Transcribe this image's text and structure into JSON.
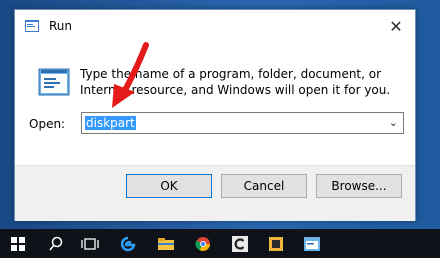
{
  "window": {
    "title": "Run",
    "close_glyph": "✕"
  },
  "dialog": {
    "description": "Type the name of a program, folder, document, or Internet resource, and Windows will open it for you.",
    "open_label": "Open:",
    "command_value": "diskpart",
    "caret_glyph": "⌄"
  },
  "buttons": {
    "ok": "OK",
    "cancel": "Cancel",
    "browse": "Browse..."
  },
  "colors": {
    "accent": "#0078d7",
    "selection": "#3399ff",
    "annotation_arrow": "#e31b1b",
    "desktop": "#1e4f8a",
    "taskbar": "#0f1218"
  },
  "taskbar": {
    "items": [
      "windows-start-icon",
      "search-icon",
      "task-view-icon",
      "edge-browser-icon",
      "file-explorer-icon",
      "chrome-icon",
      "app-c-icon",
      "app-square-icon",
      "run-app-icon"
    ]
  }
}
